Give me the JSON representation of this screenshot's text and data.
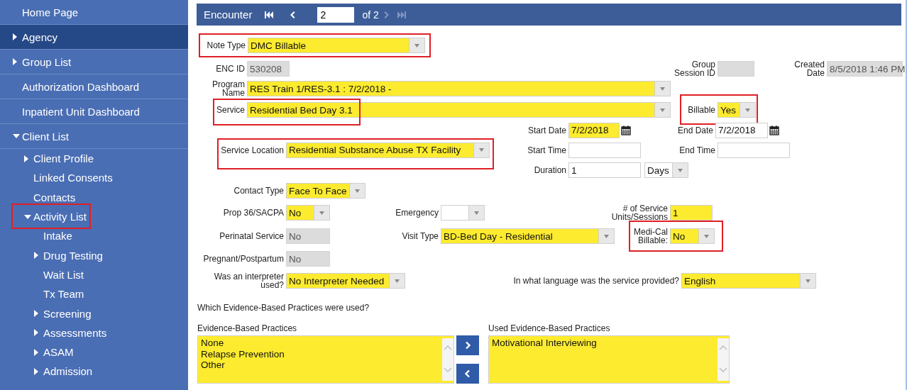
{
  "sidebar": {
    "items": [
      {
        "label": "Home Page",
        "selected": false
      },
      {
        "label": "Agency",
        "expanded": false,
        "selected": true
      },
      {
        "label": "Group List",
        "expanded": false,
        "selected": false
      },
      {
        "label": "Authorization Dashboard",
        "selected": false
      },
      {
        "label": "Inpatient Unit Dashboard",
        "selected": false
      },
      {
        "label": "Client List",
        "expanded": true,
        "selected": false,
        "children": [
          {
            "label": "Client Profile",
            "expanded": false,
            "selected": false
          },
          {
            "label": "Linked Consents",
            "selected": false
          },
          {
            "label": "Contacts",
            "selected": false
          },
          {
            "label": "Activity List",
            "expanded": true,
            "selected": false,
            "highlighted": true,
            "children": [
              {
                "label": "Intake",
                "selected": false
              },
              {
                "label": "Drug Testing",
                "expanded": false,
                "selected": false
              },
              {
                "label": "Wait List",
                "selected": false
              },
              {
                "label": "Tx Team",
                "selected": false
              },
              {
                "label": "Screening",
                "expanded": false,
                "selected": false
              },
              {
                "label": "Assessments",
                "expanded": false,
                "selected": false
              },
              {
                "label": "ASAM",
                "expanded": false,
                "selected": false
              },
              {
                "label": "Admission",
                "expanded": false,
                "selected": false
              }
            ]
          }
        ]
      }
    ]
  },
  "header": {
    "title": "Encounter",
    "page": "2",
    "total": "of 2",
    "nav": [
      {
        "kind": "first",
        "disabled": false
      },
      {
        "kind": "prev",
        "disabled": false
      },
      {
        "kind": "next",
        "disabled": true
      },
      {
        "kind": "last",
        "disabled": true
      }
    ]
  },
  "form": {
    "note_type": {
      "label": "Note Type",
      "value": "DMC Billable",
      "kind": "select",
      "required": true,
      "highlighted": true
    },
    "enc_id": {
      "label": "ENC ID",
      "value": "530208",
      "kind": "readonly"
    },
    "group_session_id": {
      "label": "Group Session ID",
      "kind": "readonly"
    },
    "created_date": {
      "label": "Created Date",
      "value": "8/5/2018 1:46 PM",
      "kind": "readonly"
    },
    "program_name": {
      "label": "Program Name",
      "value": "RES Train 1/RES-3.1 : 7/2/2018 -",
      "kind": "select",
      "required": true
    },
    "service": {
      "label": "Service",
      "value": "Residential Bed Day 3.1",
      "kind": "select",
      "required": true,
      "highlighted": true
    },
    "billable": {
      "label": "Billable",
      "value": "Yes",
      "kind": "select",
      "required": true,
      "highlighted": true
    },
    "start_date": {
      "label": "Start Date",
      "value": "7/2/2018",
      "kind": "date",
      "required": true
    },
    "end_date": {
      "label": "End Date",
      "value": "7/2/2018",
      "kind": "date",
      "required": false
    },
    "service_location": {
      "label": "Service Location",
      "value": "Residential Substance Abuse TX Facility",
      "kind": "select",
      "required": true,
      "highlighted": true
    },
    "start_time": {
      "label": "Start Time",
      "kind": "text",
      "required": false
    },
    "end_time": {
      "label": "End Time",
      "kind": "text",
      "required": false
    },
    "duration": {
      "label": "Duration",
      "value": "1",
      "kind": "text",
      "required": false
    },
    "duration_unit": {
      "value": "Days",
      "kind": "select",
      "required": false
    },
    "contact_type": {
      "label": "Contact Type",
      "value": "Face To Face",
      "kind": "select",
      "required": true
    },
    "prop36": {
      "label": "Prop 36/SACPA",
      "value": "No",
      "kind": "select",
      "required": true
    },
    "emergency": {
      "label": "Emergency",
      "kind": "select",
      "required": false
    },
    "service_units": {
      "label": "# of Service Units/Sessions",
      "value": "1",
      "kind": "text",
      "required": true
    },
    "perinatal": {
      "label": "Perinatal Service",
      "value": "No",
      "kind": "readonly"
    },
    "visit_type": {
      "label": "Visit Type",
      "value": "BD-Bed Day - Residential",
      "kind": "select",
      "required": true
    },
    "medi_cal": {
      "label": "Medi-Cal Billable:",
      "value": "No",
      "kind": "select",
      "required": true,
      "highlighted": true
    },
    "pregnant": {
      "label": "Pregnant/Postpartum",
      "value": "No",
      "kind": "readonly"
    },
    "interpreter": {
      "label": "Was an interpreter used?",
      "value": "No Interpreter Needed",
      "kind": "select",
      "required": true
    },
    "language": {
      "label": "In what language was the service provided?",
      "value": "English",
      "kind": "select",
      "required": true
    }
  },
  "practices": {
    "question": "Which Evidence-Based Practices were used?",
    "available": {
      "label": "Evidence-Based Practices",
      "required": true,
      "options": [
        "None",
        "Relapse Prevention",
        "Other"
      ]
    },
    "used": {
      "label": "Used Evidence-Based Practices",
      "required": true,
      "options": [
        "Motivational Interviewing"
      ]
    }
  }
}
